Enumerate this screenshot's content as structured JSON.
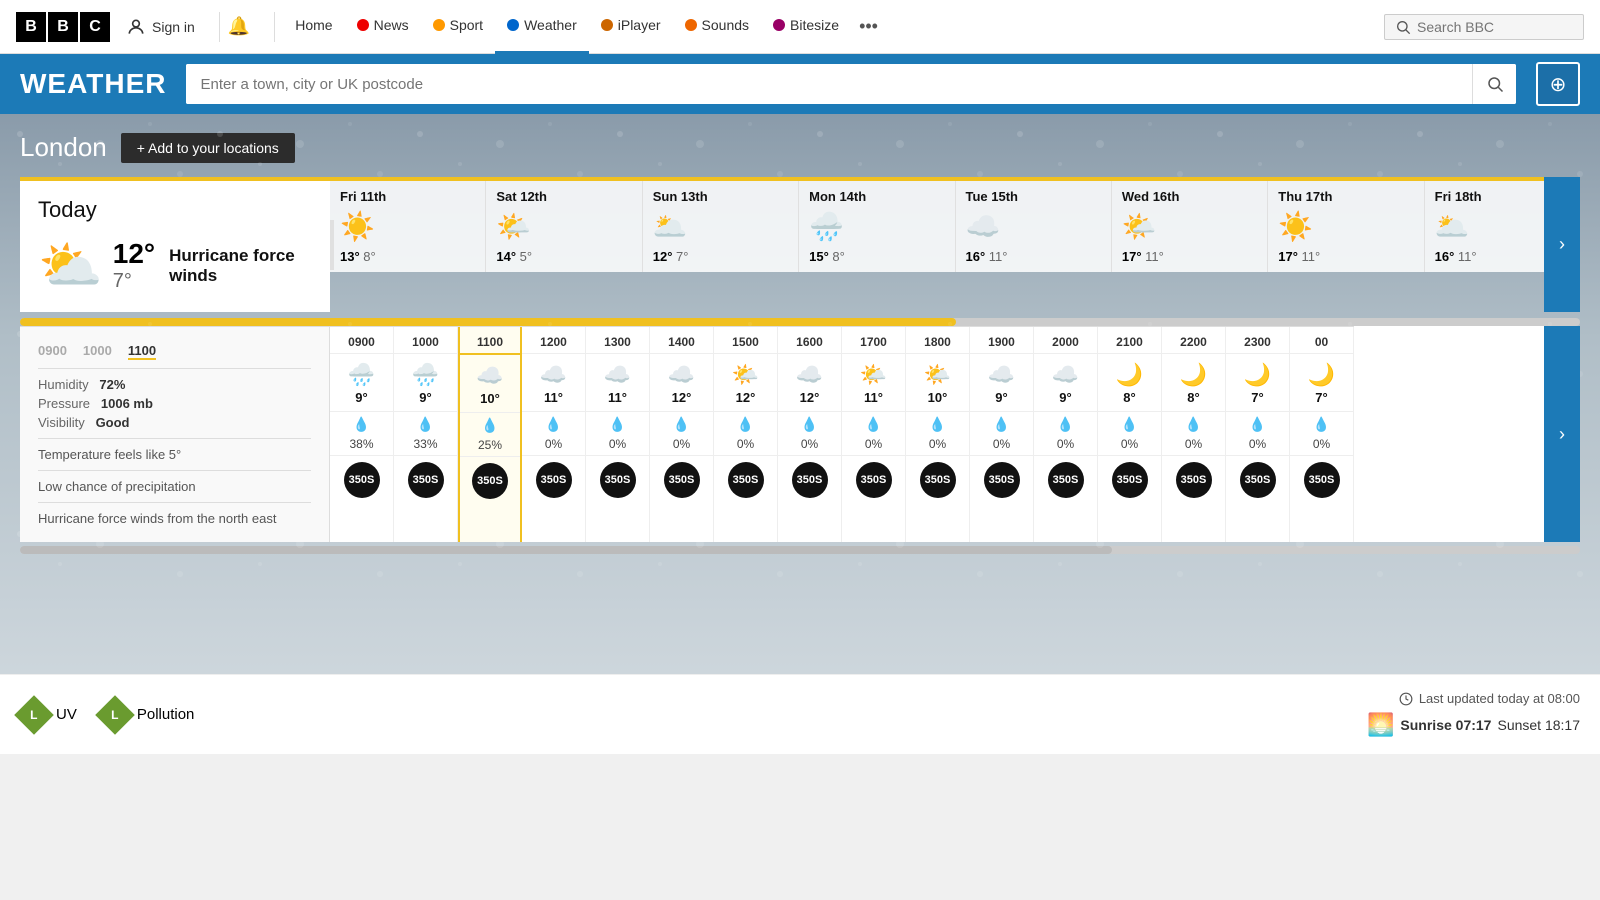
{
  "topnav": {
    "logo": [
      "B",
      "B",
      "C"
    ],
    "signin_label": "Sign in",
    "bell_label": "Notifications",
    "links": [
      {
        "name": "home",
        "label": "Home",
        "dot": "none"
      },
      {
        "name": "news",
        "label": "News",
        "dot": "dot-red"
      },
      {
        "name": "sport",
        "label": "Sport",
        "dot": "dot-yellow"
      },
      {
        "name": "weather",
        "label": "Weather",
        "dot": "dot-blue"
      },
      {
        "name": "iplayer",
        "label": "iPlayer",
        "dot": "dot-purple"
      },
      {
        "name": "sounds",
        "label": "Sounds",
        "dot": "dot-orange"
      },
      {
        "name": "bitesize",
        "label": "Bitesize",
        "dot": "dot-violet"
      }
    ],
    "more_label": "•••",
    "search_placeholder": "Search BBC"
  },
  "weather_header": {
    "title": "WEATHER",
    "search_placeholder": "Enter a town, city or UK postcode"
  },
  "location": {
    "name": "London",
    "add_label": "+ Add to your locations"
  },
  "today": {
    "label": "Today",
    "high": "12°",
    "low": "7°",
    "description": "Hurricane force winds"
  },
  "forecast": [
    {
      "day": "Fri 11th",
      "high": "13°",
      "low": "8°",
      "icon": "☀️"
    },
    {
      "day": "Sat 12th",
      "high": "14°",
      "low": "5°",
      "icon": "🌤️"
    },
    {
      "day": "Sun 13th",
      "high": "12°",
      "low": "7°",
      "icon": "🌥️"
    },
    {
      "day": "Mon 14th",
      "high": "15°",
      "low": "8°",
      "icon": "🌧️"
    },
    {
      "day": "Tue 15th",
      "high": "16°",
      "low": "11°",
      "icon": "☁️"
    },
    {
      "day": "Wed 16th",
      "high": "17°",
      "low": "11°",
      "icon": "🌤️"
    },
    {
      "day": "Thu 17th",
      "high": "17°",
      "low": "11°",
      "icon": "☀️"
    },
    {
      "day": "Fri 18th",
      "high": "16°",
      "low": "11°",
      "icon": "🌥️"
    }
  ],
  "hourly_detail": {
    "time": "1100",
    "humidity_label": "Humidity",
    "humidity_value": "72%",
    "pressure_label": "Pressure",
    "pressure_value": "1006 mb",
    "visibility_label": "Visibility",
    "visibility_value": "Good",
    "feels_like": "Temperature feels like 5°",
    "precip_label": "Low chance of precipitation",
    "wind_label": "Hurricane force winds from the north east"
  },
  "hours": [
    {
      "time": "0900",
      "icon": "🌧️",
      "temp": "9°",
      "precip": "38%",
      "wind": "350S",
      "active": false
    },
    {
      "time": "1000",
      "icon": "🌧️",
      "temp": "9°",
      "precip": "33%",
      "wind": "350S",
      "active": false
    },
    {
      "time": "1100",
      "icon": "☁️",
      "temp": "10°",
      "precip": "25%",
      "wind": "350S",
      "active": true
    },
    {
      "time": "1200",
      "icon": "☁️",
      "temp": "11°",
      "precip": "0%",
      "wind": "350S",
      "active": false
    },
    {
      "time": "1300",
      "icon": "☁️",
      "temp": "11°",
      "precip": "0%",
      "wind": "350S",
      "active": false
    },
    {
      "time": "1400",
      "icon": "☁️",
      "temp": "12°",
      "precip": "0%",
      "wind": "350S",
      "active": false
    },
    {
      "time": "1500",
      "icon": "🌤️",
      "temp": "12°",
      "precip": "0%",
      "wind": "350S",
      "active": false
    },
    {
      "time": "1600",
      "icon": "☁️",
      "temp": "12°",
      "precip": "0%",
      "wind": "350S",
      "active": false
    },
    {
      "time": "1700",
      "icon": "🌤️",
      "temp": "11°",
      "precip": "0%",
      "wind": "350S",
      "active": false
    },
    {
      "time": "1800",
      "icon": "🌤️",
      "temp": "10°",
      "precip": "0%",
      "wind": "350S",
      "active": false
    },
    {
      "time": "1900",
      "icon": "☁️",
      "temp": "9°",
      "precip": "0%",
      "wind": "350S",
      "active": false
    },
    {
      "time": "2000",
      "icon": "☁️",
      "temp": "9°",
      "precip": "0%",
      "wind": "350S",
      "active": false
    },
    {
      "time": "2100",
      "icon": "🌙",
      "temp": "8°",
      "precip": "0%",
      "wind": "350S",
      "active": false
    },
    {
      "time": "2200",
      "icon": "🌙",
      "temp": "8°",
      "precip": "0%",
      "wind": "350S",
      "active": false
    },
    {
      "time": "2300",
      "icon": "🌙",
      "temp": "7°",
      "precip": "0%",
      "wind": "350S",
      "active": false
    },
    {
      "time": "0000",
      "icon": "🌙",
      "temp": "7°",
      "precip": "0%",
      "wind": "350S",
      "active": false
    }
  ],
  "bottom": {
    "uv_label": "UV",
    "uv_badge": "L",
    "pollution_label": "Pollution",
    "pollution_badge": "L",
    "last_updated": "Last updated today at 08:00",
    "sunrise_label": "Sunrise 07:17",
    "sunset_label": "Sunset 18:17"
  }
}
